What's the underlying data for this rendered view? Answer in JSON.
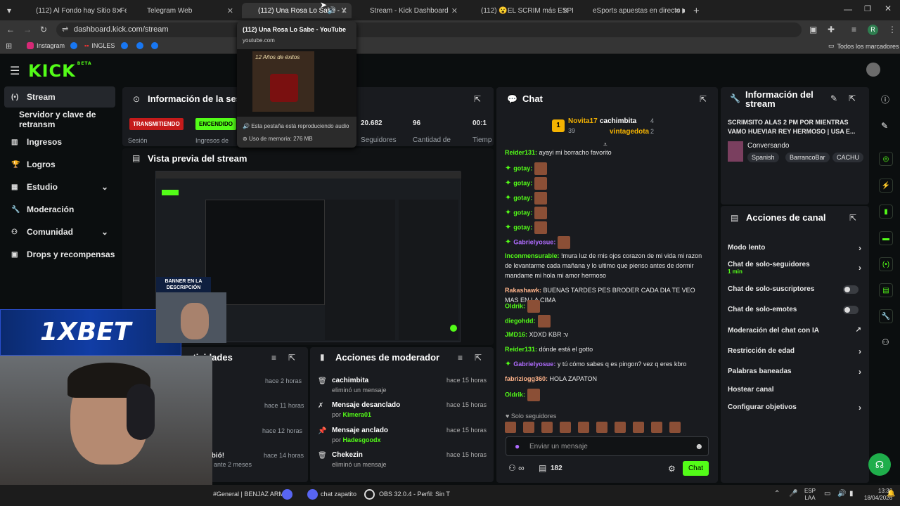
{
  "browser": {
    "tabs": [
      {
        "label": "(112) Al Fondo hay Sitio 8: Ferm",
        "fav": "#e62117"
      },
      {
        "label": "Telegram Web",
        "fav": "#2aa3df"
      },
      {
        "label": "(112) Una Rosa Lo Sabe - Y",
        "fav": "#e62117",
        "active": true
      },
      {
        "label": "Stream - Kick Dashboard",
        "fav": "#53fc18"
      },
      {
        "label": "(112) 😮EL SCRIM más ESPERA",
        "fav": "#e62117"
      },
      {
        "label": "eSports apuestas en directo ▶",
        "fav": "#1a5bb8"
      }
    ],
    "url": "dashboard.kick.com/stream",
    "bookmarks": [
      "Instagram",
      "INGLES"
    ],
    "all_bookmarks": "Todos los marcadores",
    "profile_letter": "R",
    "tooltip": {
      "title": "(112) Una Rosa Lo Sabe - YouTube",
      "domain": "youtube.com",
      "audio": "Esta pestaña está reproduciendo audio",
      "memory": "Uso de memoria: 276 MB",
      "thumb_text": "12 Años de éxitos"
    }
  },
  "kick": {
    "logo": "KICK",
    "beta": "BETA",
    "sidebar": [
      {
        "label": "Stream",
        "icon": "broadcast-icon",
        "active": true
      },
      {
        "label": "Servidor y clave de retransm",
        "icon": ""
      },
      {
        "label": "Ingresos",
        "icon": "bar-chart-icon"
      },
      {
        "label": "Logros",
        "icon": "trophy-icon"
      },
      {
        "label": "Estudio",
        "icon": "grid-icon",
        "chevron": true
      },
      {
        "label": "Moderación",
        "icon": "wrench-icon"
      },
      {
        "label": "Comunidad",
        "icon": "users-icon",
        "chevron": true
      },
      {
        "label": "Drops y recompensas",
        "icon": "gift-icon"
      }
    ],
    "session": {
      "title": "Información de la ses",
      "status_live": "TRANSMITIENDO",
      "status_on": "ENCENDIDO",
      "session_label": "Sesión",
      "income_label": "Ingresos de",
      "followers_value": "20.682",
      "followers_label": "Seguidores",
      "count_value": "96",
      "count_label": "Cantidad de",
      "time_value": "00:1",
      "time_label": "Tiemp"
    },
    "preview": {
      "title": "Vista previa del stream",
      "banner": "BANNER EN LA DESCRIPCIÓN"
    },
    "activity": {
      "title": "actividades",
      "times": [
        "hace 2 horas",
        "hace 11 horas",
        "hace 12 horas",
        "hace 14 horas"
      ],
      "snippet": "ibió!",
      "snippet2": "ante 2 meses"
    },
    "mod_actions": {
      "title": "Acciones de moderador",
      "rows": [
        {
          "h": "cachimbita",
          "s": "eliminó un mensaje",
          "t": "hace 15 horas",
          "icon": "trash-icon"
        },
        {
          "h": "Mensaje desanclado",
          "s": "por ",
          "by": "Kimera01",
          "t": "hace 15 horas",
          "icon": "unpin-icon"
        },
        {
          "h": "Mensaje anclado",
          "s": "por ",
          "by": "Hadesgoodx",
          "t": "hace 15 horas",
          "icon": "pin-icon"
        },
        {
          "h": "Chekezin",
          "s": "eliminó un mensaje",
          "t": "hace 15 horas",
          "icon": "trash-icon"
        }
      ]
    },
    "chat": {
      "title": "Chat",
      "gifter1": "Novita17",
      "gifter1_count": "39",
      "gifter2": "cachimbita",
      "gifter2_count": "4",
      "gifter3": "vintagedota",
      "gifter3_count": "2",
      "rank": "1",
      "lines": [
        {
          "user": "Reider131",
          "color": "#53fc18",
          "text": " ayayi mi borracho favorito"
        },
        {
          "user": "gotay",
          "color": "#53fc18",
          "badge": true,
          "emote": true
        },
        {
          "user": "gotay",
          "color": "#53fc18",
          "badge": true,
          "emote": true
        },
        {
          "user": "gotay",
          "color": "#53fc18",
          "badge": true,
          "emote": true
        },
        {
          "user": "gotay",
          "color": "#53fc18",
          "badge": true,
          "emote": true
        },
        {
          "user": "gotay",
          "color": "#53fc18",
          "badge": true,
          "emote": true
        },
        {
          "user": "Gabrielyosue",
          "color": "#b06cff",
          "badge": true,
          "emote": true
        },
        {
          "user": "Inconmensurable",
          "color": "#53fc18",
          "text": " !mura luz de mis ojos corazon de mi vida mi razon de levantarme cada mañana y lo ultimo que pienso antes de dormir mandame mi hola mi amor hermoso"
        },
        {
          "user": "Rakashawk",
          "color": "#ffb38a",
          "text": " BUENAS TARDES PES BRODER CADA DIA TE VEO MAS EN LA CIMA"
        },
        {
          "user": "Oldrik",
          "color": "#53fc18",
          "emote": true
        },
        {
          "user": "diegohdd",
          "color": "#53fc18",
          "emote": true
        },
        {
          "user": "JMD16",
          "color": "#53fc18",
          "text": " XDXD KBR :v"
        },
        {
          "user": "Reider131",
          "color": "#53fc18",
          "text": " dónde está el gotto"
        },
        {
          "user": "Gabrielyosue",
          "color": "#b06cff",
          "badge": true,
          "text": " y tú cómo sabes q es pingon? vez q eres kbro"
        },
        {
          "user": "fabriziogg360",
          "color": "#ffb38a",
          "text": " HOLA ZAPATON"
        },
        {
          "user": "Oldrik",
          "color": "#53fc18",
          "emote": true
        }
      ],
      "followers_only": "Solo seguidores",
      "placeholder": "Enviar un mensaje",
      "viewers": "182",
      "send": "Chat"
    },
    "stream_info": {
      "title": "Información del stream",
      "stream_title": "SCRIMSITO ALAS 2 PM POR MIENTRAS VAMO HUEVIAR REY HERMOSO | USA E...",
      "category": "Conversando",
      "tags": [
        "Spanish",
        "BarrancoBar",
        "CACHU"
      ]
    },
    "channel_actions": {
      "title": "Acciones de canal",
      "rows": [
        {
          "label": "Modo lento",
          "kind": "chev"
        },
        {
          "label": "Chat de solo-seguidores",
          "sub": "1 min",
          "kind": "chev"
        },
        {
          "label": "Chat de solo-suscriptores",
          "kind": "toggle"
        },
        {
          "label": "Chat de solo-emotes",
          "kind": "toggle"
        },
        {
          "label": "Moderación del chat con IA",
          "kind": "ext"
        },
        {
          "label": "Restricción de edad",
          "kind": "chev"
        },
        {
          "label": "Palabras baneadas",
          "kind": "chev"
        },
        {
          "label": "Hostear canal",
          "kind": ""
        },
        {
          "label": "Configurar objetivos",
          "kind": "chev"
        }
      ]
    }
  },
  "overlay": {
    "brand": "1XBET"
  },
  "taskbar": {
    "item1": "#General | BENJAZ ARM",
    "item2": "chat zapatito",
    "item3": "OBS 32.0.4 - Perfil: Sin T",
    "lang": "ESP",
    "lang2": "LAA",
    "time": "13:36",
    "date": "18/04/2026"
  }
}
